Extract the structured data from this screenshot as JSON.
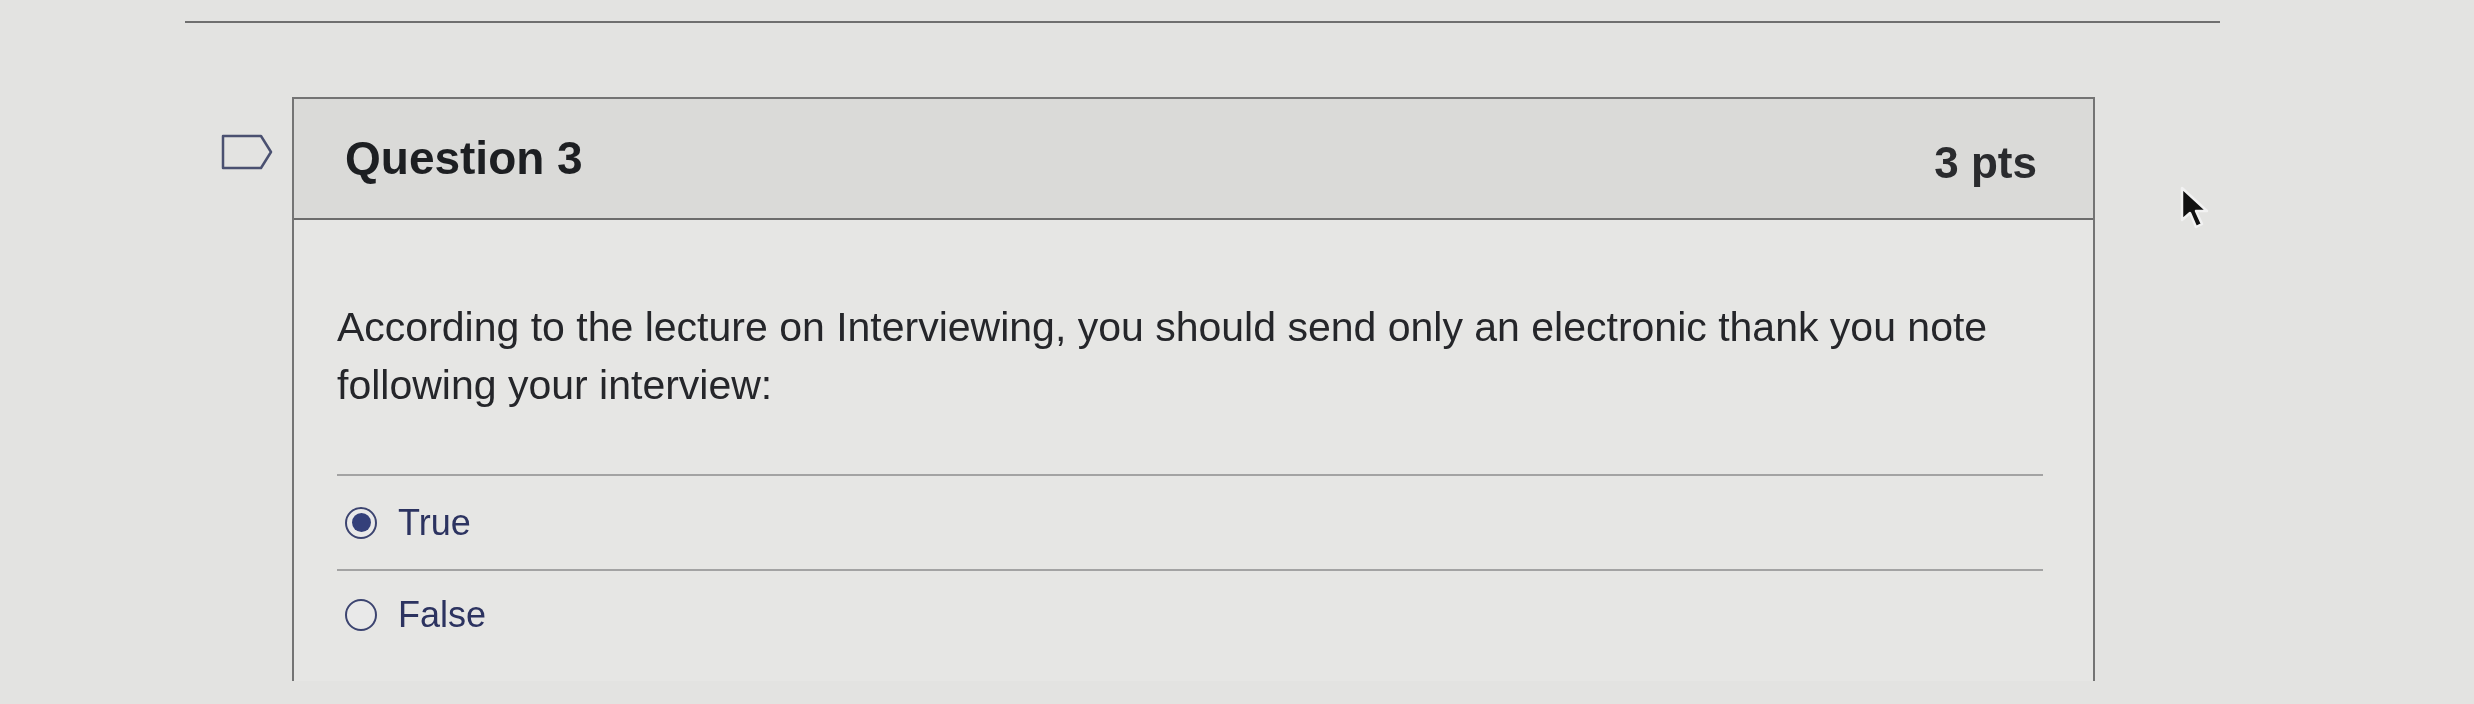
{
  "question": {
    "flagged": false,
    "title": "Question 3",
    "points": "3 pts",
    "text": "According to the lecture on Interviewing, you should send only an electronic thank you note following your interview:",
    "answers": [
      {
        "label": "True",
        "selected": true
      },
      {
        "label": "False",
        "selected": false
      }
    ]
  }
}
